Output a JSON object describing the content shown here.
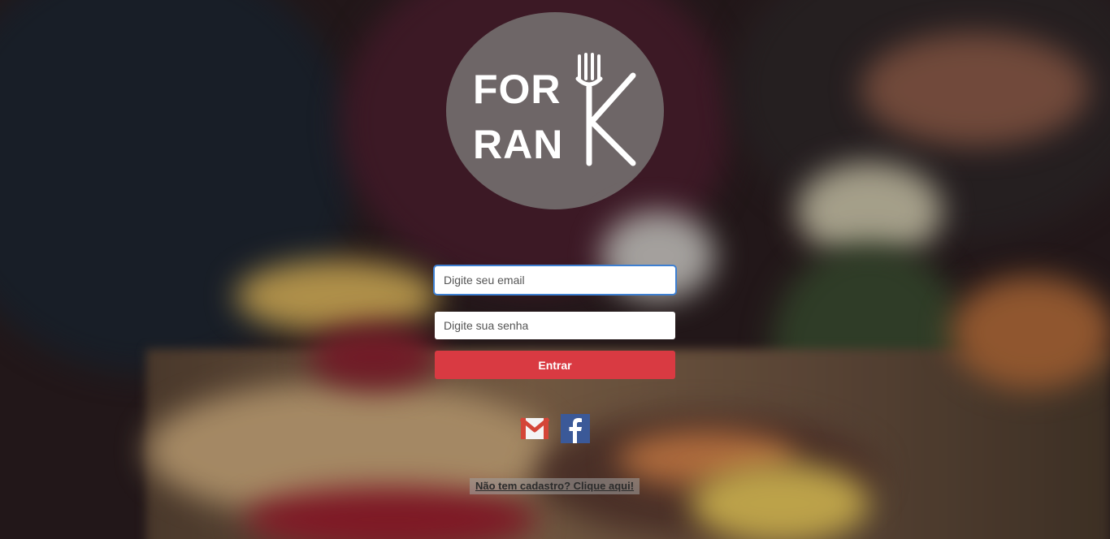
{
  "logo": {
    "line1": "FOR",
    "line2": "RAN",
    "brand_letter": "K",
    "fork_icon": "fork-icon"
  },
  "login": {
    "email_placeholder": "Digite seu email",
    "password_placeholder": "Digite sua senha",
    "submit_label": "Entrar"
  },
  "social": [
    {
      "name": "gmail",
      "icon": "gmail-icon"
    },
    {
      "name": "facebook",
      "icon": "facebook-icon"
    }
  ],
  "signup_link": "Não tem cadastro? Clique aqui!",
  "colors": {
    "accent": "#d93a42",
    "logo_bg": "#736c6c",
    "facebook": "#3b5998"
  }
}
